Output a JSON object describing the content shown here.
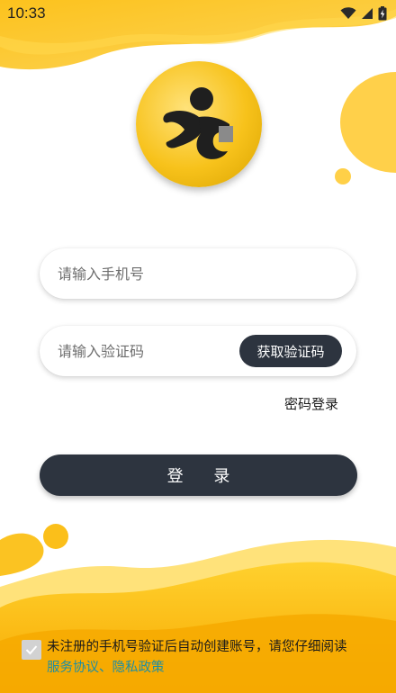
{
  "status_bar": {
    "time": "10:33",
    "icons": [
      "wifi-icon",
      "cellular-signal-icon",
      "battery-charging-icon"
    ]
  },
  "logo": {
    "icon": "app-logo-icon"
  },
  "phone_field": {
    "placeholder": "请输入手机号",
    "value": ""
  },
  "code_field": {
    "placeholder": "请输入验证码",
    "value": ""
  },
  "get_code_button": "获取验证码",
  "password_login_link": "密码登录",
  "login_button": "登 录",
  "agreement": {
    "checked": true,
    "text": "未注册的手机号验证后自动创建账号，请您仔细阅读",
    "links": "服务协议、隐私政策"
  },
  "colors": {
    "accent_yellow": "#f9b800",
    "dark_button": "#2d343f",
    "link": "#1e8ea3"
  }
}
